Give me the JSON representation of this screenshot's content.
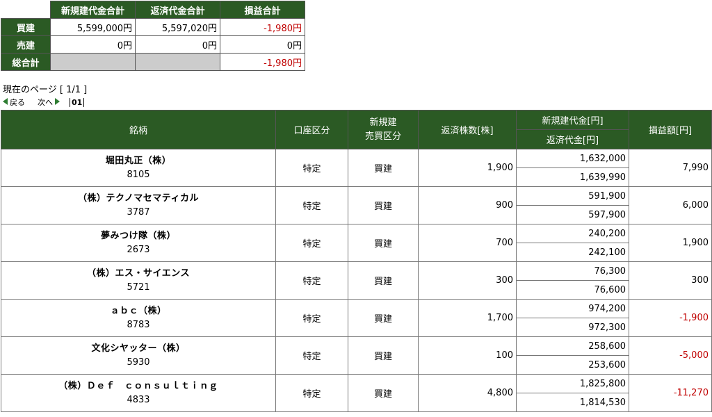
{
  "summary": {
    "headers": [
      "新規建代金合計",
      "返済代金合計",
      "損益合計"
    ],
    "rows": [
      {
        "label": "買建",
        "new": "5,599,000円",
        "close": "5,597,020円",
        "pl": "-1,980円",
        "pl_neg": true
      },
      {
        "label": "売建",
        "new": "0円",
        "close": "0円",
        "pl": "0円",
        "pl_neg": false
      },
      {
        "label": "総合計",
        "new": "",
        "close": "",
        "pl": "-1,980円",
        "pl_neg": true
      }
    ]
  },
  "page_info": "現在のページ [ 1/1 ]",
  "pager": {
    "back": "戻る",
    "next": "次へ",
    "current": "01"
  },
  "table": {
    "headers": {
      "name": "銘柄",
      "account": "口座区分",
      "side_line1": "新規建",
      "side_line2": "売買区分",
      "qty": "返済株数[株]",
      "new_amount": "新規建代金[円]",
      "close_amount": "返済代金[円]",
      "pl": "損益額[円]"
    },
    "rows": [
      {
        "name": "堀田丸正（株）",
        "code": "8105",
        "account": "特定",
        "side": "買建",
        "qty": "1,900",
        "new": "1,632,000",
        "close": "1,639,990",
        "pl": "7,990",
        "neg": false
      },
      {
        "name": "（株）テクノマセマティカル",
        "code": "3787",
        "account": "特定",
        "side": "買建",
        "qty": "900",
        "new": "591,900",
        "close": "597,900",
        "pl": "6,000",
        "neg": false
      },
      {
        "name": "夢みつけ隊（株）",
        "code": "2673",
        "account": "特定",
        "side": "買建",
        "qty": "700",
        "new": "240,200",
        "close": "242,100",
        "pl": "1,900",
        "neg": false
      },
      {
        "name": "（株）エス・サイエンス",
        "code": "5721",
        "account": "特定",
        "side": "買建",
        "qty": "300",
        "new": "76,300",
        "close": "76,600",
        "pl": "300",
        "neg": false
      },
      {
        "name": "ａｂｃ（株）",
        "code": "8783",
        "account": "特定",
        "side": "買建",
        "qty": "1,700",
        "new": "974,200",
        "close": "972,300",
        "pl": "-1,900",
        "neg": true
      },
      {
        "name": "文化シヤッター（株）",
        "code": "5930",
        "account": "特定",
        "side": "買建",
        "qty": "100",
        "new": "258,600",
        "close": "253,600",
        "pl": "-5,000",
        "neg": true
      },
      {
        "name": "（株）Ｄｅｆ　ｃｏｎｓｕｌｔｉｎｇ",
        "code": "4833",
        "account": "特定",
        "side": "買建",
        "qty": "4,800",
        "new": "1,825,800",
        "close": "1,814,530",
        "pl": "-11,270",
        "neg": true
      }
    ]
  },
  "colors": {
    "header_bg": "#2b5a24",
    "negative": "#c00000",
    "pager_arrow": "#2e7d32"
  }
}
